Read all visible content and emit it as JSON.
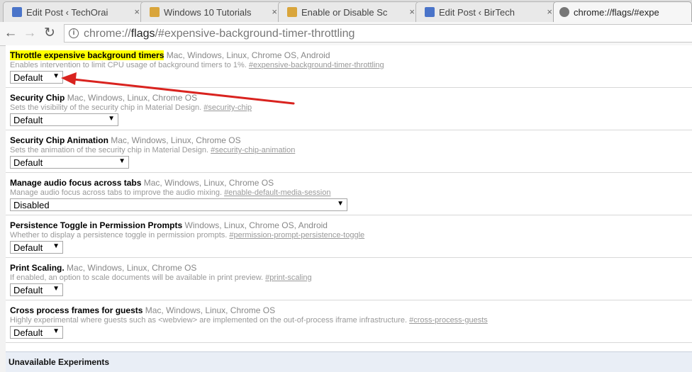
{
  "tabs": [
    {
      "title": "Edit Post ‹ TechOrai",
      "favicon_color": "#4a74c9"
    },
    {
      "title": "Windows 10 Tutorials",
      "favicon_color": "#d9a53b"
    },
    {
      "title": "Enable or Disable Sc",
      "favicon_color": "#d9a53b"
    },
    {
      "title": "Edit Post ‹ BirTech",
      "favicon_color": "#4a74c9"
    },
    {
      "title": "chrome://flags/#expe",
      "favicon_color": "#777777",
      "active": true
    }
  ],
  "toolbar": {
    "back": "←",
    "forward": "→",
    "reload": "↻",
    "info_icon": "i",
    "url_scheme": "chrome://",
    "url_host": "flags",
    "url_rest": "/#expensive-background-timer-throttling"
  },
  "experiments": [
    {
      "name": "Throttle expensive background timers",
      "platforms": "Mac, Windows, Linux, Chrome OS, Android",
      "description": "Enables intervention to limit CPU usage of background timers to 1%.",
      "permalink": "#expensive-background-timer-throttling",
      "value": "Default"
    },
    {
      "name": "Security Chip",
      "platforms": "Mac, Windows, Linux, Chrome OS",
      "description": "Sets the visibility of the security chip in Material Design.",
      "permalink": "#security-chip",
      "value": "Default"
    },
    {
      "name": "Security Chip Animation",
      "platforms": "Mac, Windows, Linux, Chrome OS",
      "description": "Sets the animation of the security chip in Material Design.",
      "permalink": "#security-chip-animation",
      "value": "Default"
    },
    {
      "name": "Manage audio focus across tabs",
      "platforms": "Mac, Windows, Linux, Chrome OS",
      "description": "Manage audio focus across tabs to improve the audio mixing.",
      "permalink": "#enable-default-media-session",
      "value": "Disabled"
    },
    {
      "name": "Persistence Toggle in Permission Prompts",
      "platforms": "Windows, Linux, Chrome OS, Android",
      "description": "Whether to display a persistence toggle in permission prompts.",
      "permalink": "#permission-prompt-persistence-toggle",
      "value": "Default"
    },
    {
      "name": "Print Scaling.",
      "platforms": "Mac, Windows, Linux, Chrome OS",
      "description": "If enabled, an option to scale documents will be available in print preview.",
      "permalink": "#print-scaling",
      "value": "Default"
    },
    {
      "name": "Cross process frames for guests",
      "platforms": "Mac, Windows, Linux, Chrome OS",
      "description": "Highly experimental where guests such as <webview> are implemented on the out-of-process iframe infrastructure.",
      "permalink": "#cross-process-guests",
      "value": "Default"
    }
  ],
  "unavailable_heading": "Unavailable Experiments",
  "dropdown_caret": "▼",
  "tab_close": "×",
  "colors": {
    "highlight": "#ffff00",
    "annotation_arrow": "#d9231f"
  }
}
